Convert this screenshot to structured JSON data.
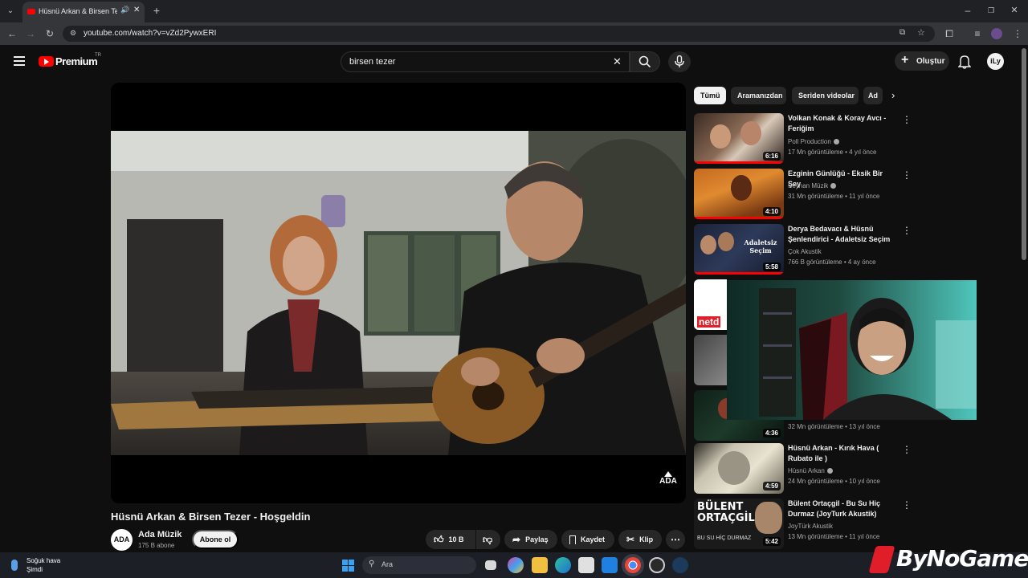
{
  "browser": {
    "tab_title": "Hüsnü Arkan & Birsen Tezer - Hoşgeldin",
    "url": "youtube.com/watch?v=vZd2PywxERI"
  },
  "header": {
    "logo_text": "Premium",
    "region": "TR",
    "search_value": "birsen tezer",
    "create_label": "Oluştur",
    "avatar_text": "iLy"
  },
  "player": {
    "watermark_text": "ADA"
  },
  "video": {
    "title": "Hüsnü Arkan & Birsen Tezer - Hoşgeldin",
    "channel": "Ada Müzik",
    "channel_avatar": "ADA",
    "subscribers": "175 B abone",
    "subscribe_label": "Abone ol",
    "likes": "10 B",
    "share_label": "Paylaş",
    "save_label": "Kaydet",
    "clip_label": "Klip"
  },
  "chips": [
    "Tümü",
    "Aramanızdan",
    "Seriden videolar",
    "Ad"
  ],
  "recommendations": [
    {
      "title": "Volkan Konak & Koray Avcı - Feriğim",
      "channel": "Poll Production",
      "meta": "17 Mn görüntüleme • 4 yıl önce",
      "duration": "6:16",
      "verified": true
    },
    {
      "title": "Ezginin Günlüğü - Eksik Bir Şey",
      "channel": "Seyhan Müzik",
      "meta": "31 Mn görüntüleme • 11 yıl önce",
      "duration": "4:10",
      "verified": true
    },
    {
      "title": "Derya Bedavacı & Hüsnü Şenlendirici - Adaletsiz Seçim",
      "channel": "Çok Akustik",
      "meta": "766 B görüntüleme • 4 ay önce",
      "duration": "5:58",
      "verified": false,
      "thumb_text": "Adaletsiz Seçim"
    },
    {
      "meta": "32 Mn görüntüleme • 13 yıl önce",
      "duration": "4:36"
    },
    {
      "title": "Hüsnü Arkan - Kırık Hava ( Rubato ile )",
      "channel": "Hüsnü Arkan",
      "meta": "24 Mn görüntüleme • 10 yıl önce",
      "duration": "4:59",
      "verified": true
    },
    {
      "title": "Bülent Ortaçgil - Bu Su Hiç Durmaz (JoyTurk Akustik)",
      "channel": "JoyTürk Akustik",
      "meta": "13 Mn görüntüleme • 11 yıl önce",
      "duration": "5:42",
      "verified": false,
      "thumb_text": "BÜLENT ORTAÇGİL",
      "thumb_subtext": "BU SU HİÇ DURMAZ"
    }
  ],
  "partial_thumb_text": "netd",
  "taskbar": {
    "weather_title": "Soğuk hava",
    "weather_sub": "Şimdi",
    "search_placeholder": "Ara"
  },
  "watermark": "ByNoGame",
  "colors": {
    "background": "#0f0f0f",
    "youtube_red": "#ff0000",
    "chip_active": "#f1f1f1",
    "chip": "#272727"
  }
}
